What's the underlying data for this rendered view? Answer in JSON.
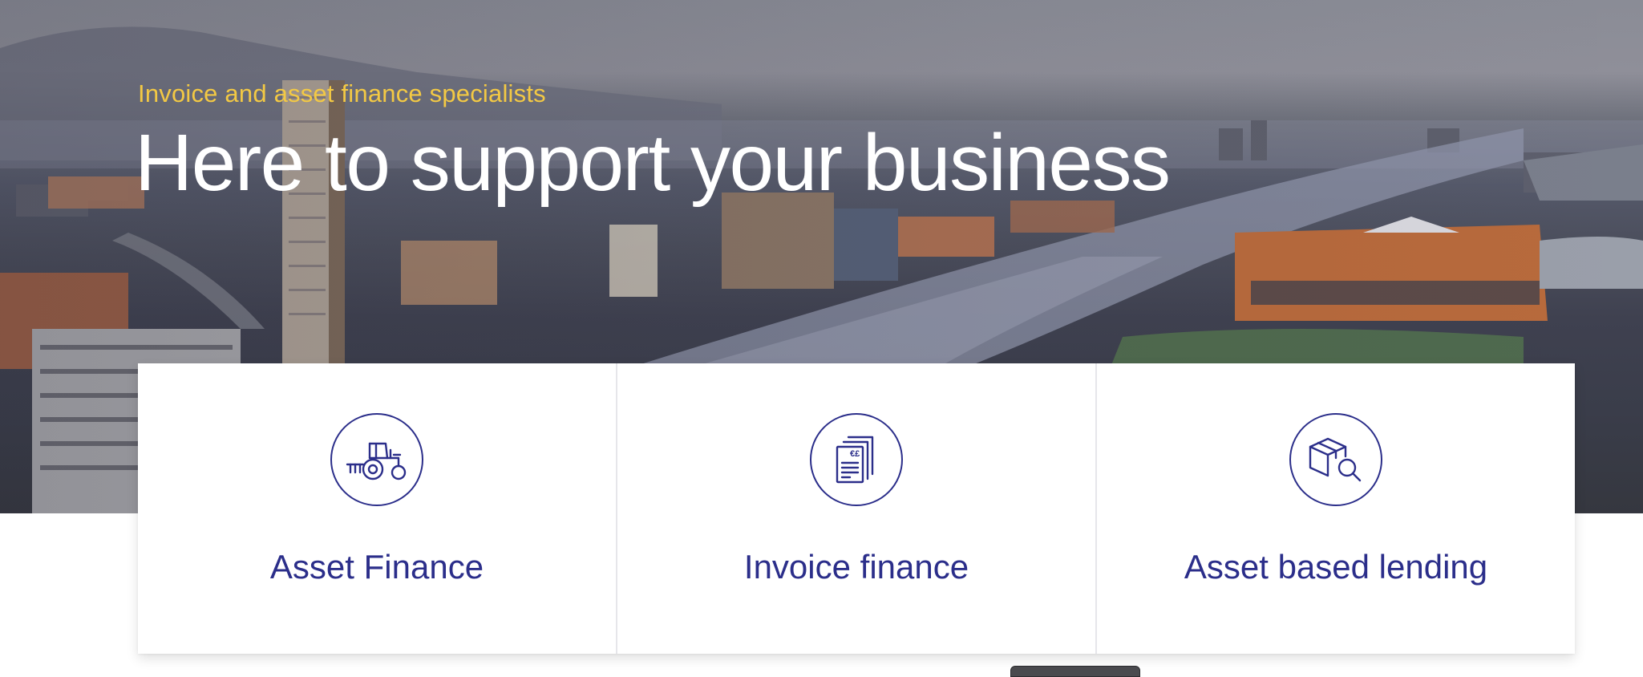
{
  "hero": {
    "eyebrow": "Invoice and asset finance specialists",
    "headline": "Here to support your business"
  },
  "cards": [
    {
      "label": "Asset Finance",
      "icon": "tractor-icon"
    },
    {
      "label": "Invoice finance",
      "icon": "invoice-documents-icon"
    },
    {
      "label": "Asset based lending",
      "icon": "box-search-icon"
    }
  ],
  "colors": {
    "accent": "#2b2e8a",
    "eyebrow": "#f3c944",
    "headline": "#ffffff"
  }
}
